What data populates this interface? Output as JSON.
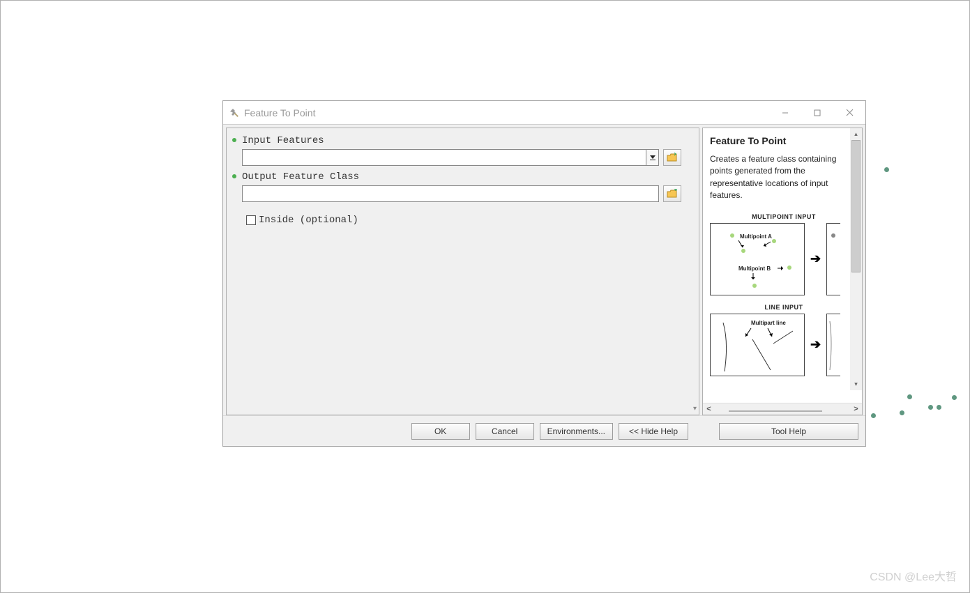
{
  "window": {
    "title": "Feature To Point"
  },
  "form": {
    "input_features": {
      "label": "Input Features",
      "value": ""
    },
    "output_feature_class": {
      "label": "Output Feature Class",
      "value": ""
    },
    "inside": {
      "label": "Inside (optional)",
      "checked": false
    }
  },
  "buttons": {
    "ok": "OK",
    "cancel": "Cancel",
    "environments": "Environments...",
    "hide_help": "<< Hide Help",
    "tool_help": "Tool Help"
  },
  "help": {
    "title": "Feature To Point",
    "description": "Creates a feature class containing points generated from the representative locations of input features.",
    "diagram1_title": "MULTIPOINT INPUT",
    "diagram1_labelA": "Multipoint A",
    "diagram1_labelB": "Multipoint B",
    "diagram2_title": "LINE INPUT",
    "diagram2_label": "Multipart line"
  },
  "watermark": "CSDN @Lee大哲"
}
